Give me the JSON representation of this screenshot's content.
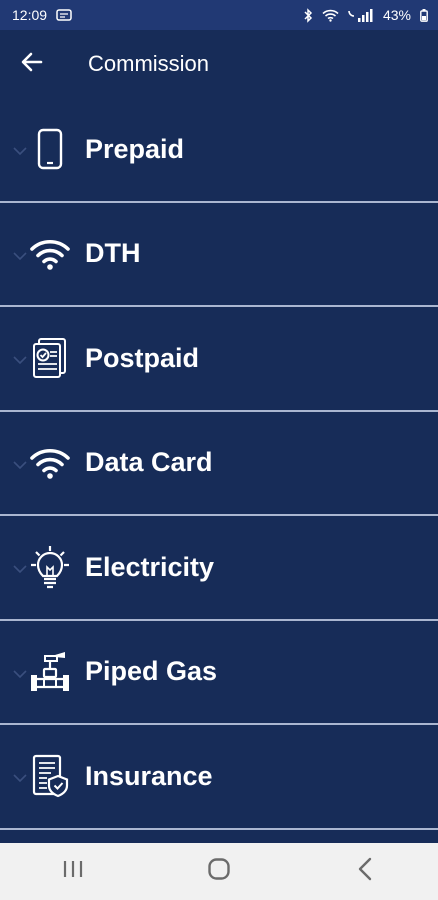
{
  "status": {
    "time": "12:09",
    "battery": "43%"
  },
  "header": {
    "title": "Commission",
    "back_icon": "arrow-left-icon"
  },
  "items": [
    {
      "label": "Prepaid",
      "icon": "mobile-phone-icon"
    },
    {
      "label": "DTH",
      "icon": "wifi-signal-icon"
    },
    {
      "label": "Postpaid",
      "icon": "bill-document-icon"
    },
    {
      "label": "Data Card",
      "icon": "wifi-signal-icon"
    },
    {
      "label": "Electricity",
      "icon": "light-bulb-icon"
    },
    {
      "label": "Piped Gas",
      "icon": "gas-pipe-icon"
    },
    {
      "label": "Insurance",
      "icon": "insurance-document-icon"
    }
  ],
  "nav": {
    "buttons": [
      "recent-apps-icon",
      "home-icon",
      "back-icon"
    ]
  },
  "colors": {
    "background": "#172c58",
    "status_bar": "#213974",
    "divider": "#aab6d0",
    "text": "#ffffff",
    "nav_bar": "#f1f1f1"
  }
}
